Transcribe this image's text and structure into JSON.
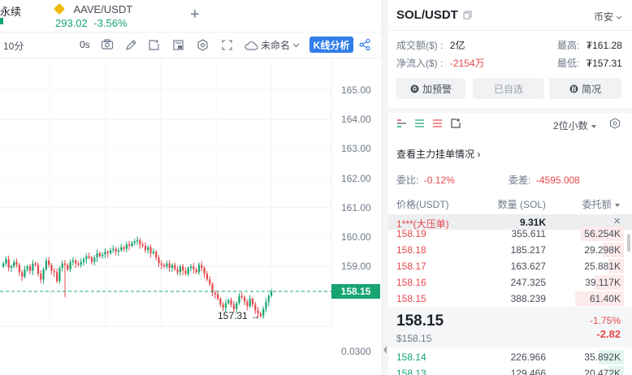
{
  "tabs": [
    {
      "label": "永续",
      "sub": ""
    },
    {
      "label": "AAVE/USDT",
      "price": "293.02",
      "change": "-3.56%"
    }
  ],
  "add_tab_icon": "plus-icon",
  "toolbar": {
    "interval": "10分",
    "interval2": "0s",
    "layout_name": "未命名",
    "analysis_button": "K线分析"
  },
  "chart": {
    "price_axis": [
      "165.00",
      "164.00",
      "163.00",
      "162.00",
      "161.00",
      "160.00",
      "159.00"
    ],
    "last_price": "158.15",
    "low_marker": "157.31 →",
    "volume_tick": "0.0300",
    "colors": {
      "up": "#16a571",
      "down": "#e5484d"
    }
  },
  "chart_data": {
    "type": "candlestick",
    "y_ticks": [
      159.0,
      160.0,
      161.0,
      162.0,
      163.0,
      164.0,
      165.0
    ],
    "last_price": 158.15,
    "low_label": 157.31
  },
  "panel": {
    "symbol": "SOL/USDT",
    "exchange": "币安",
    "stats": {
      "volume_label": "成交额($) :",
      "volume_value": "2亿",
      "inflow_label": "净流入($) :",
      "inflow_value": "-2154万",
      "high_label": "最高:",
      "high_value": "₮161.28",
      "low_label": "最低:",
      "low_value": "₮157.31"
    },
    "buttons": {
      "alert": "加预警",
      "watch": "已自选",
      "brief": "简况"
    },
    "precision": "2位小数",
    "order_book_link": "查看主力挂单情况",
    "ratio_label": "委比:",
    "ratio_value": "-0.12%",
    "diff_label": "委差:",
    "diff_value": "-4595.008",
    "columns": {
      "price": "价格(USDT)",
      "qty": "数量 (SOL)",
      "total": "委托额"
    },
    "big_order": {
      "label": "1***(大压单)",
      "qty": "9.31K"
    },
    "asks": [
      {
        "price": "158.19",
        "qty": "355.611",
        "total": "56.254K",
        "fill": 0.62
      },
      {
        "price": "158.18",
        "qty": "185.217",
        "total": "29.298K",
        "fill": 0.3
      },
      {
        "price": "158.17",
        "qty": "163.627",
        "total": "25.881K",
        "fill": 0.22
      },
      {
        "price": "158.16",
        "qty": "247.325",
        "total": "39.117K",
        "fill": 0.42
      },
      {
        "price": "158.15",
        "qty": "388.239",
        "total": "61.40K",
        "fill": 0.7
      }
    ],
    "current": {
      "price": "158.15",
      "usd": "$158.15",
      "change_pct": "-1.75%",
      "change_abs": "-2.82"
    },
    "bids": [
      {
        "price": "158.14",
        "qty": "226.966",
        "total": "35.892K",
        "fill": 0.36
      },
      {
        "price": "158.13",
        "qty": "129.466",
        "total": "20.472K",
        "fill": 0.22
      }
    ]
  }
}
